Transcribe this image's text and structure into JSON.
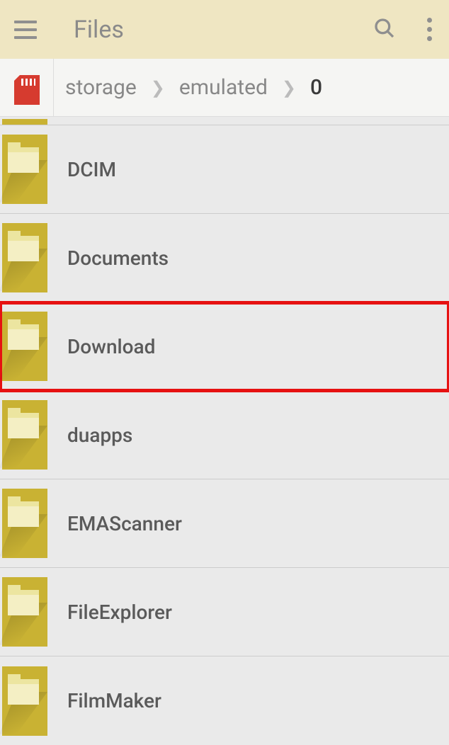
{
  "header": {
    "title": "Files"
  },
  "breadcrumb": {
    "items": [
      {
        "label": "storage",
        "current": false
      },
      {
        "label": "emulated",
        "current": false
      },
      {
        "label": "0",
        "current": true
      }
    ]
  },
  "files": [
    {
      "name": "DCIM",
      "highlighted": false
    },
    {
      "name": "Documents",
      "highlighted": false
    },
    {
      "name": "Download",
      "highlighted": true
    },
    {
      "name": "duapps",
      "highlighted": false
    },
    {
      "name": "EMAScanner",
      "highlighted": false
    },
    {
      "name": "FileExplorer",
      "highlighted": false
    },
    {
      "name": "FilmMaker",
      "highlighted": false
    }
  ]
}
